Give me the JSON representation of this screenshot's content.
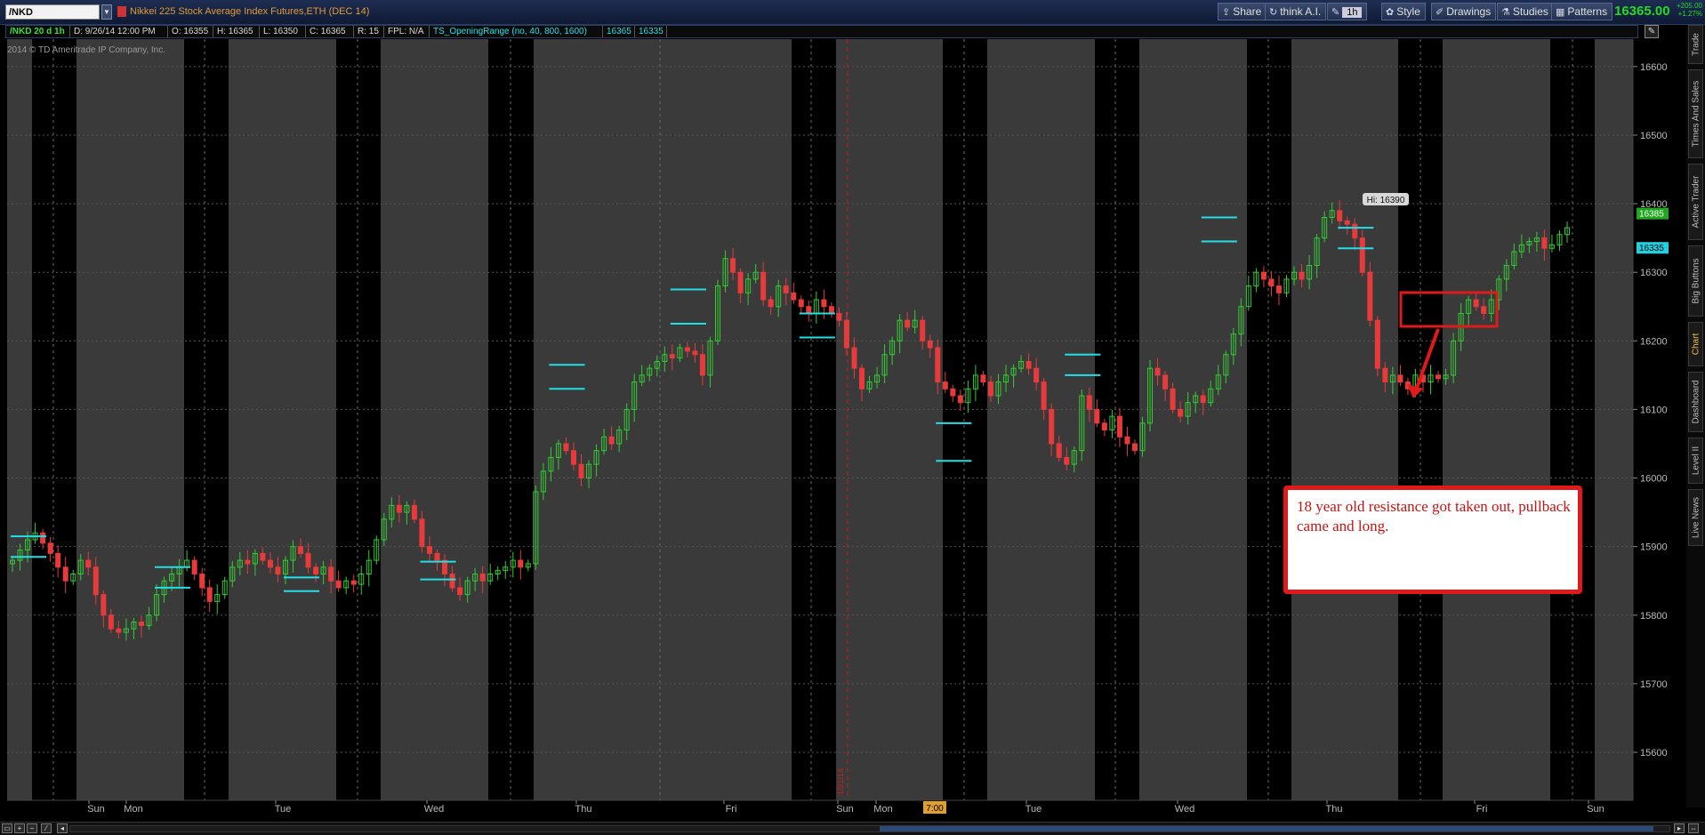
{
  "toolbar": {
    "symbol": "/NKD",
    "description": "Nikkei 225 Stock Average Index Futures,ETH (DEC 14)",
    "buttons": [
      {
        "label": "Share",
        "icon": "share-icon"
      },
      {
        "label": "think A.I.",
        "icon": "refresh-icon"
      },
      {
        "label": "1h",
        "icon": "wrench-icon"
      },
      {
        "label": "Style",
        "icon": "gear-icon"
      },
      {
        "label": "Drawings",
        "icon": "pencil-icon"
      },
      {
        "label": "Studies",
        "icon": "flask-icon"
      },
      {
        "label": "Patterns",
        "icon": "pattern-icon"
      }
    ],
    "last_price": "16365.00",
    "change_abs": "+205.00",
    "change_pct": "+1.27%"
  },
  "infobar": {
    "period": "/NKD 20 d 1h",
    "date": "D: 9/26/14 12:00 PM",
    "open": "O: 16355",
    "high": "H: 16365",
    "low": "L: 16350",
    "close": "C: 16365",
    "range": "R: 15",
    "fpl": "FPL: N/A",
    "study": "TS_OpeningRange (no, 40, 800, 1600)",
    "study_v1": "16365",
    "study_v2": "16335"
  },
  "copyright": "2014 © TD Ameritrade IP Company, Inc.",
  "chart_data": {
    "type": "candlestick",
    "yticks": [
      "16600",
      "16500",
      "16400",
      "16300",
      "16200",
      "16100",
      "16000",
      "15900",
      "15800",
      "15700",
      "15600"
    ],
    "ylim": [
      15530,
      16640
    ],
    "day_labels": [
      "Sun",
      "Mon",
      "Tue",
      "Wed",
      "Thu",
      "Fri",
      "Sun",
      "Mon",
      "Tue",
      "Wed",
      "Thu",
      "Fri",
      "Sun"
    ],
    "time_marker": "7:00",
    "vline_label": "10/1/14",
    "high_label": "Hi: 16390",
    "price_label_1": "16385",
    "price_label_2": "16335",
    "bar_up_color": "#33cc33",
    "bar_down_color": "#e83a3a",
    "opening_range_color": "#22e0e8",
    "closes": [
      15880,
      15895,
      15910,
      15920,
      15905,
      15890,
      15870,
      15850,
      15860,
      15880,
      15870,
      15830,
      15800,
      15780,
      15775,
      15780,
      15790,
      15785,
      15800,
      15830,
      15850,
      15860,
      15870,
      15880,
      15860,
      15840,
      15820,
      15830,
      15850,
      15870,
      15880,
      15875,
      15890,
      15880,
      15870,
      15860,
      15880,
      15900,
      15890,
      15870,
      15860,
      15870,
      15850,
      15840,
      15850,
      15845,
      15860,
      15880,
      15910,
      15940,
      15960,
      15950,
      15960,
      15940,
      15900,
      15890,
      15880,
      15860,
      15840,
      15830,
      15850,
      15860,
      15850,
      15860,
      15865,
      15870,
      15880,
      15870,
      15875,
      15980,
      16010,
      16030,
      16050,
      16040,
      16020,
      16000,
      16020,
      16040,
      16060,
      16050,
      16070,
      16100,
      16140,
      16150,
      16160,
      16170,
      16180,
      16175,
      16190,
      16185,
      16180,
      16150,
      16200,
      16280,
      16320,
      16300,
      16270,
      16290,
      16300,
      16260,
      16250,
      16280,
      16270,
      16260,
      16250,
      16240,
      16260,
      16250,
      16240,
      16230,
      16190,
      16160,
      16130,
      16140,
      16150,
      16180,
      16200,
      16230,
      16220,
      16230,
      16200,
      16190,
      16140,
      16130,
      16120,
      16110,
      16130,
      16150,
      16140,
      16120,
      16140,
      16150,
      16160,
      16170,
      16160,
      16140,
      16100,
      16050,
      16030,
      16020,
      16040,
      16120,
      16100,
      16080,
      16070,
      16090,
      16060,
      16050,
      16040,
      16080,
      16160,
      16150,
      16130,
      16100,
      16090,
      16110,
      16120,
      16110,
      16130,
      16150,
      16180,
      16210,
      16250,
      16280,
      16300,
      16290,
      16280,
      16270,
      16290,
      16300,
      16290,
      16310,
      16350,
      16380,
      16390,
      16375,
      16370,
      16350,
      16300,
      16230,
      16160,
      16140,
      16150,
      16140,
      16130,
      16150,
      16140,
      16150,
      16145,
      16150,
      16200,
      16240,
      16260,
      16250,
      16240,
      16260,
      16290,
      16310,
      16330,
      16340,
      16345,
      16350,
      16335,
      16340,
      16355,
      16365
    ]
  },
  "annotation": {
    "text": "18 year old resistance got taken out, pullback came and long."
  },
  "side_tabs": [
    "Trade",
    "Times And Sales",
    "Active Trader",
    "Big Buttons",
    "Chart",
    "Dashboard",
    "Level II",
    "Live News"
  ]
}
